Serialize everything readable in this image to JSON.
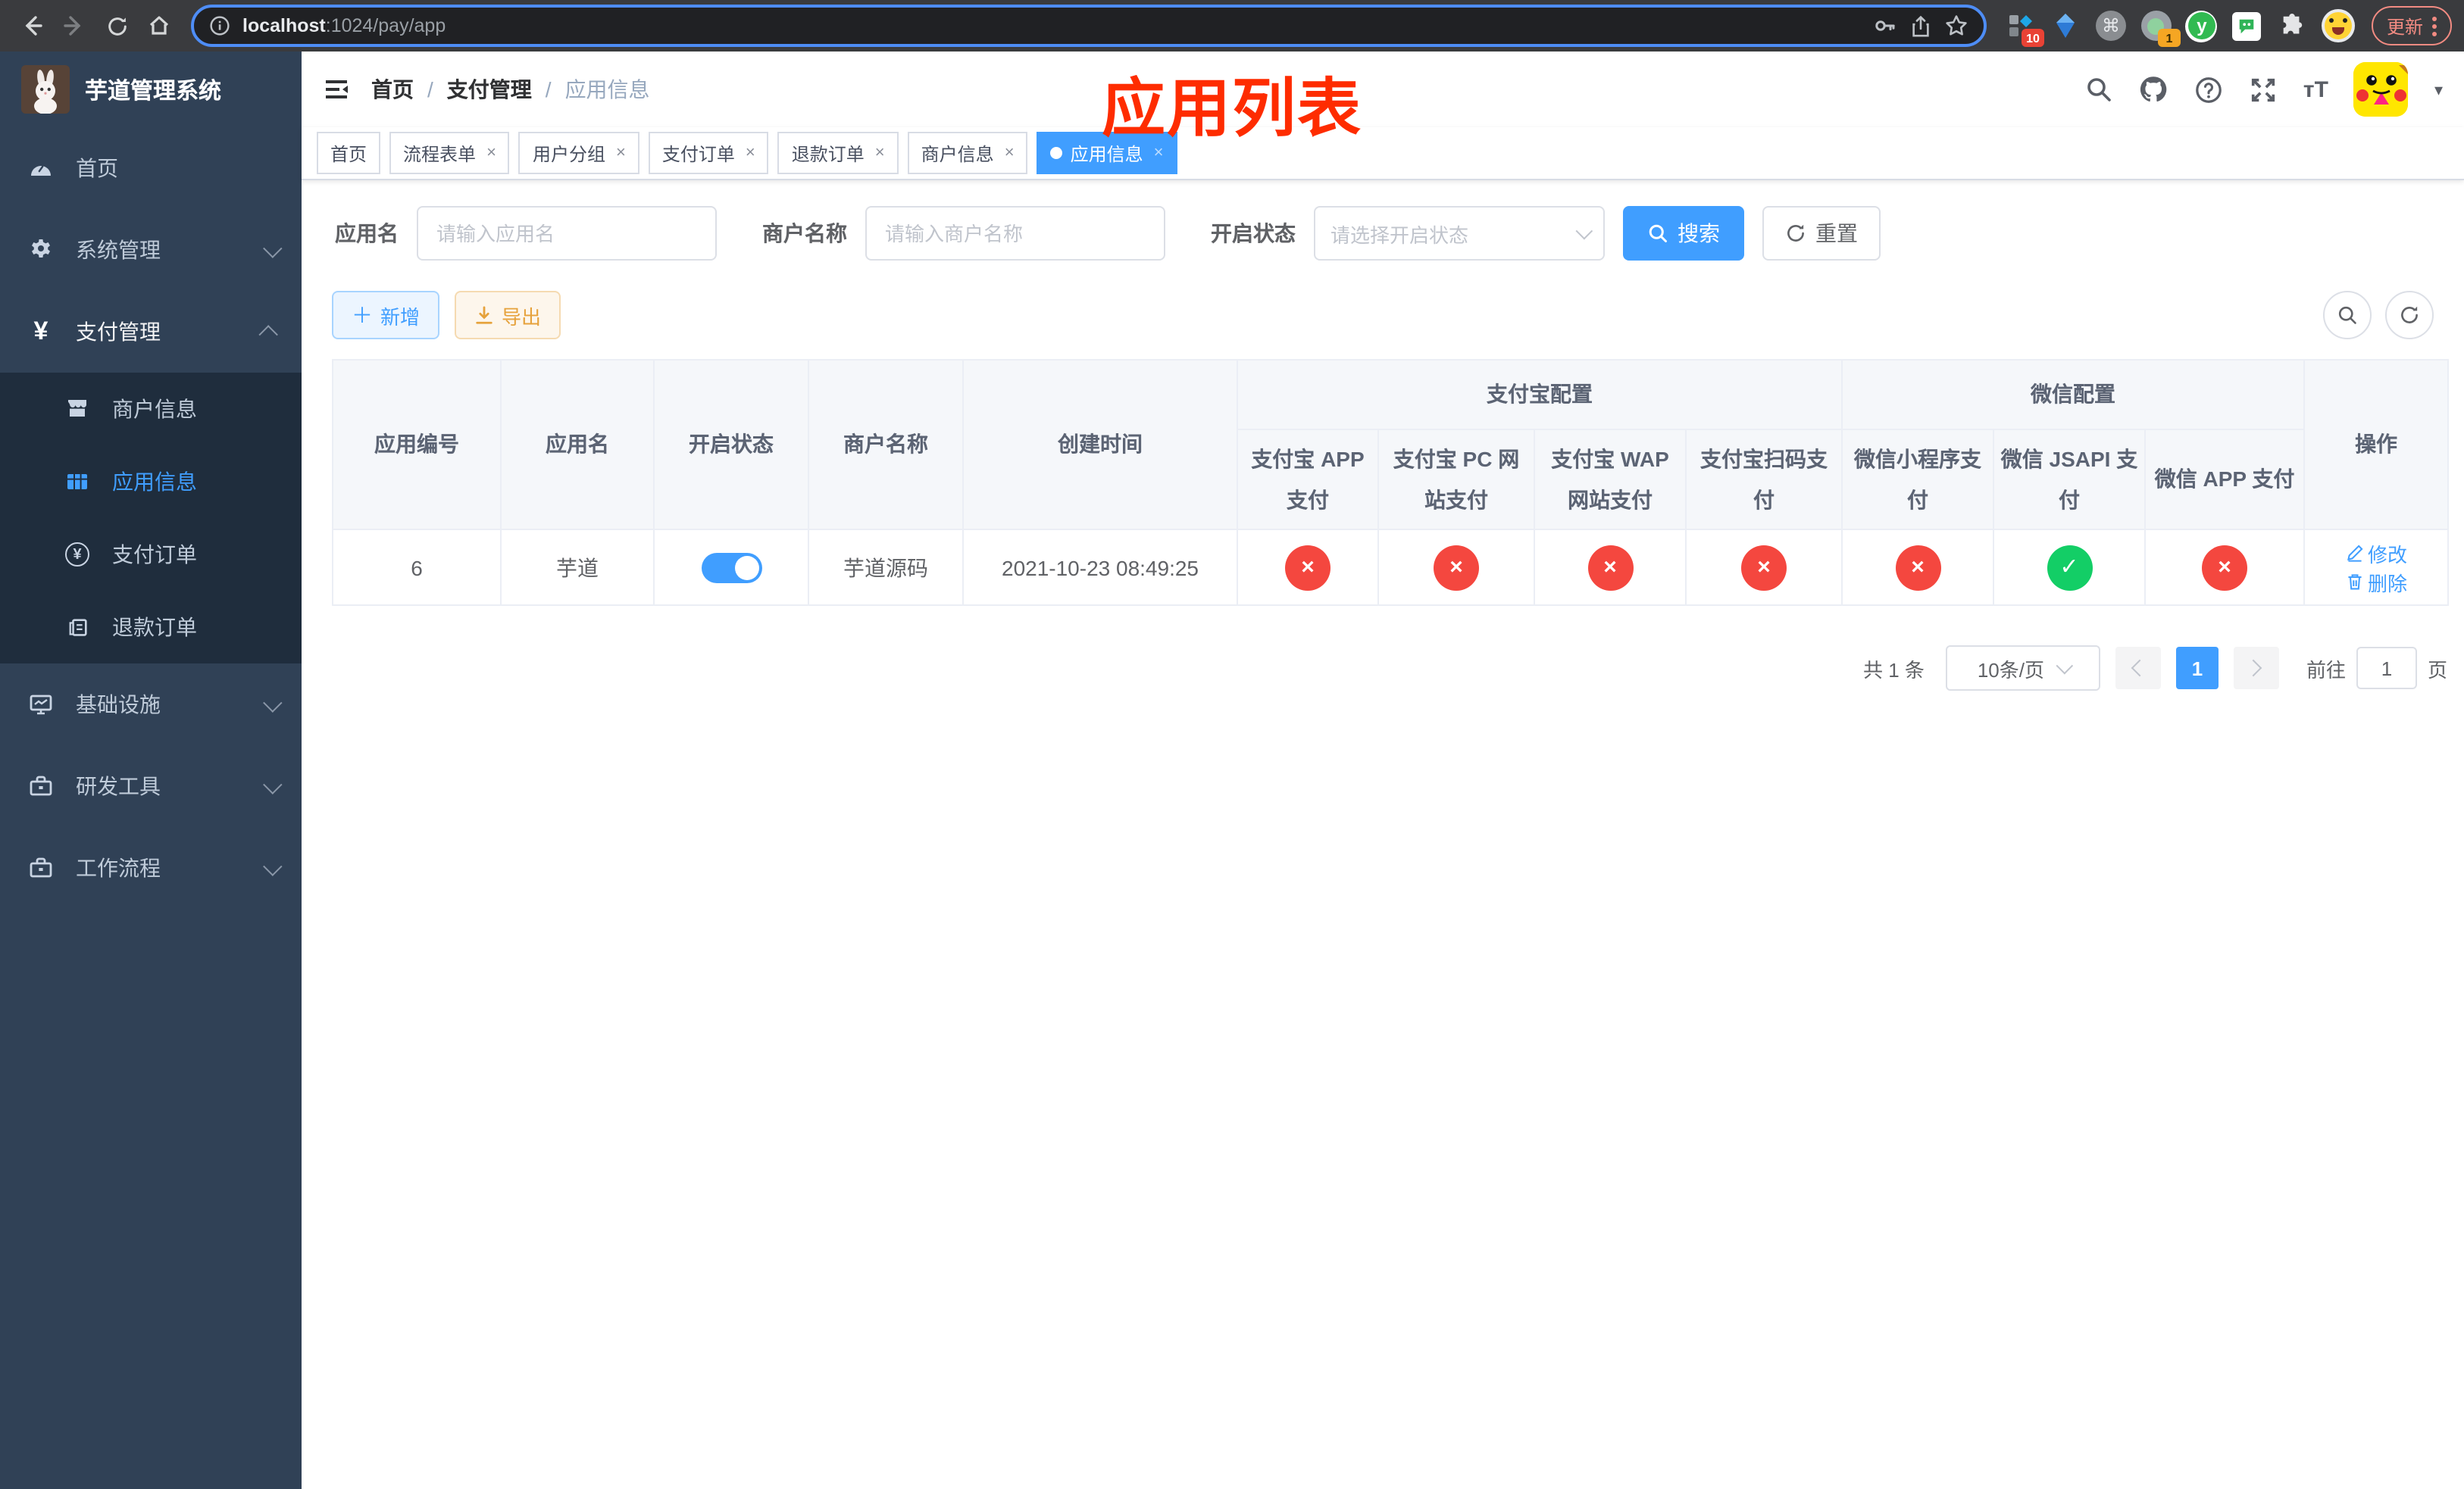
{
  "browser": {
    "url_host": "localhost",
    "url_path": ":1024/pay/app",
    "update_label": "更新",
    "ext_badge_group": "10",
    "ext_badge_tally": "1",
    "ext_y_label": "y",
    "ext_cmd_glyph": "⌘"
  },
  "sidebar": {
    "title": "芋道管理系统",
    "home": "首页",
    "system": "系统管理",
    "payment": "支付管理",
    "merchant_info": "商户信息",
    "app_info": "应用信息",
    "pay_order": "支付订单",
    "refund_order": "退款订单",
    "infra": "基础设施",
    "devtools": "研发工具",
    "workflow": "工作流程",
    "payment_icon_glyph": "¥",
    "order_icon_glyph": "¥"
  },
  "breadcrumb": {
    "home": "首页",
    "section": "支付管理",
    "current": "应用信息"
  },
  "annotation": "应用列表",
  "tabs": [
    {
      "label": "首页",
      "closable": false,
      "active": false
    },
    {
      "label": "流程表单",
      "closable": true,
      "active": false
    },
    {
      "label": "用户分组",
      "closable": true,
      "active": false
    },
    {
      "label": "支付订单",
      "closable": true,
      "active": false
    },
    {
      "label": "退款订单",
      "closable": true,
      "active": false
    },
    {
      "label": "商户信息",
      "closable": true,
      "active": false
    },
    {
      "label": "应用信息",
      "closable": true,
      "active": true
    }
  ],
  "filters": {
    "app_name_label": "应用名",
    "app_name_placeholder": "请输入应用名",
    "merchant_label": "商户名称",
    "merchant_placeholder": "请输入商户名称",
    "status_label": "开启状态",
    "status_placeholder": "请选择开启状态",
    "search_label": "搜索",
    "reset_label": "重置"
  },
  "toolbar": {
    "add_label": "新增",
    "export_label": "导出"
  },
  "table": {
    "groups": {
      "alipay": "支付宝配置",
      "wechat": "微信配置"
    },
    "columns": [
      "应用编号",
      "应用名",
      "开启状态",
      "商户名称",
      "创建时间",
      "支付宝 APP 支付",
      "支付宝 PC 网站支付",
      "支付宝 WAP 网站支付",
      "支付宝扫码支付",
      "微信小程序支付",
      "微信 JSAPI 支付",
      "微信 APP 支付",
      "操作"
    ],
    "row": {
      "id": "6",
      "name": "芋道",
      "enabled": true,
      "merchant": "芋道源码",
      "created": "2021-10-23 08:49:25",
      "pay_status": [
        false,
        false,
        false,
        false,
        false,
        true,
        false
      ]
    },
    "edit_label": "修改",
    "delete_label": "删除"
  },
  "icons": {
    "check": "✓",
    "cross": "×",
    "close": "×"
  },
  "pagination": {
    "total": "共 1 条",
    "page_size": "10条/页",
    "page": "1",
    "goto_prefix": "前往",
    "goto_value": "1",
    "goto_suffix": "页"
  },
  "colors": {
    "accent": "#409eff",
    "success": "#13ce66",
    "danger": "#f4473f",
    "warning": "#e6a23c",
    "annotation": "#fe2c00"
  }
}
